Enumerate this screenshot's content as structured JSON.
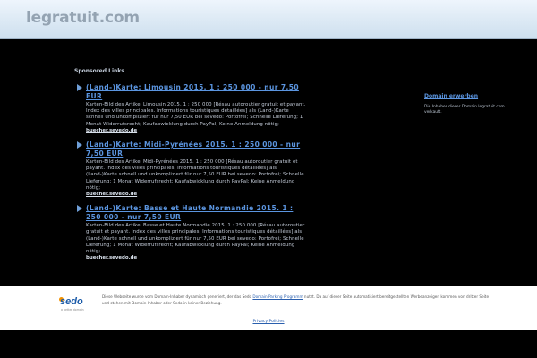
{
  "header": {
    "site_title": "legratuit.com"
  },
  "main": {
    "sponsored_heading": "Sponsored Links",
    "results": [
      {
        "title": "(Land-)Karte: Limousin 2015. 1 : 250 000 - nur 7,50 EUR",
        "description": "Karten-Bild des Artikel Limousin 2015. 1 : 250 000 [Résau autoroutier gratuit et payant. Index des villes principales. Informations touristiques détaillées] als (Land-)Karte schnell und unkompliziert für nur 7,50 EUR bei sevedo: Portofrei; Schnelle Lieferung; 1 Monat Widerrufsrecht; Kaufabwicklung durch PayPal; Keine Anmeldung nötig;",
        "url": "buecher.sevedo.de"
      },
      {
        "title": "(Land-)Karte: Midi-Pyrénées 2015. 1 : 250 000 - nur 7,50 EUR",
        "description": "Karten-Bild des Artikel Midi-Pyrénées 2015. 1 : 250 000 [Résau autoroutier gratuit et payant. Index des villes principales. Informations touristiques détaillées] als (Land-)Karte schnell und unkompliziert für nur 7,50 EUR bei sevedo: Portofrei; Schnelle Lieferung; 1 Monat Widerrufsrecht; Kaufabwicklung durch PayPal; Keine Anmeldung nötig;",
        "url": "buecher.sevedo.de"
      },
      {
        "title": "(Land-)Karte: Basse et Haute Normandie 2015. 1 : 250 000 - nur 7,50 EUR",
        "description": "Karten-Bild des Artikel Basse et Haute Normandie 2015. 1 : 250 000 [Résau autoroutier gratuit et payant. Index des villes principales. Informations touristiques détaillées] als (Land-)Karte schnell und unkompliziert für nur 7,50 EUR bei sevedo: Portofrei; Schnelle Lieferung; 1 Monat Widerrufsrecht; Kaufabwicklung durch PayPal; Keine Anmeldung nötig;",
        "url": "buecher.sevedo.de"
      }
    ],
    "side_box": {
      "title": "Domain erwerben",
      "text": "Die Inhaber dieser Domain legratuit.com verkauft."
    }
  },
  "footer": {
    "logo_word": "sedo",
    "logo_tag": "a better domain",
    "disclaimer_before": "Diese Webseite wurde vom Domain-Inhaber dynamisch generiert, der das Sedo ",
    "disclaimer_link": "Domain Parking Programm",
    "disclaimer_after": " nutzt. Da auf dieser Seite automatisiert bereitgestellten Werbeanzeigen kommen von dritter Seite und stehen mit Domain-Inhaber oder Sedo in keiner Beziehung.",
    "privacy_link": "Privacy Policies"
  },
  "colors": {
    "link": "#5b95e0",
    "header_bg": "#dce9f5",
    "body_bg": "#000000",
    "sedo_blue": "#1a5aa8",
    "sedo_orange": "#f39200"
  }
}
